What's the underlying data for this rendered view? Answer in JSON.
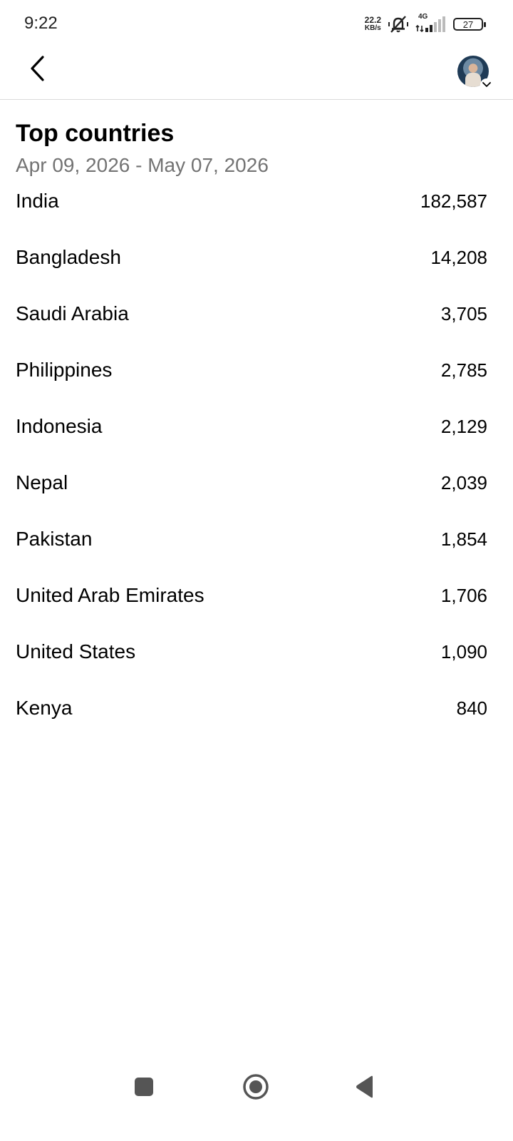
{
  "status_bar": {
    "time": "9:22",
    "net_speed_value": "22.2",
    "net_speed_unit": "KB/s",
    "network_type": "4G",
    "battery_level": "27"
  },
  "page": {
    "title": "Top countries",
    "date_range": "Apr 09, 2026 - May 07, 2026"
  },
  "countries": [
    {
      "name": "India",
      "value": "182,587"
    },
    {
      "name": "Bangladesh",
      "value": "14,208"
    },
    {
      "name": "Saudi Arabia",
      "value": "3,705"
    },
    {
      "name": "Philippines",
      "value": "2,785"
    },
    {
      "name": "Indonesia",
      "value": "2,129"
    },
    {
      "name": "Nepal",
      "value": "2,039"
    },
    {
      "name": "Pakistan",
      "value": "1,854"
    },
    {
      "name": "United Arab Emirates",
      "value": "1,706"
    },
    {
      "name": "United States",
      "value": "1,090"
    },
    {
      "name": "Kenya",
      "value": "840"
    }
  ],
  "icons": {
    "back": "chevron-left-icon",
    "avatar": "profile-avatar",
    "avatar_menu": "chevron-down-icon",
    "nav_recents": "square-icon",
    "nav_home": "circle-icon",
    "nav_back": "triangle-left-icon"
  }
}
